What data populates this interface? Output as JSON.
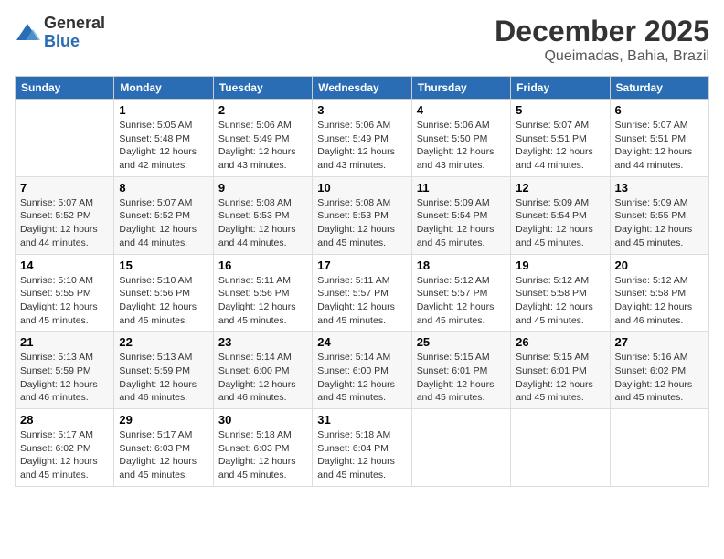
{
  "logo": {
    "general": "General",
    "blue": "Blue"
  },
  "title": "December 2025",
  "subtitle": "Queimadas, Bahia, Brazil",
  "days_of_week": [
    "Sunday",
    "Monday",
    "Tuesday",
    "Wednesday",
    "Thursday",
    "Friday",
    "Saturday"
  ],
  "weeks": [
    [
      {
        "day": null,
        "info": null
      },
      {
        "day": "1",
        "sunrise": "5:05 AM",
        "sunset": "5:48 PM",
        "daylight": "12 hours and 42 minutes."
      },
      {
        "day": "2",
        "sunrise": "5:06 AM",
        "sunset": "5:49 PM",
        "daylight": "12 hours and 43 minutes."
      },
      {
        "day": "3",
        "sunrise": "5:06 AM",
        "sunset": "5:49 PM",
        "daylight": "12 hours and 43 minutes."
      },
      {
        "day": "4",
        "sunrise": "5:06 AM",
        "sunset": "5:50 PM",
        "daylight": "12 hours and 43 minutes."
      },
      {
        "day": "5",
        "sunrise": "5:07 AM",
        "sunset": "5:51 PM",
        "daylight": "12 hours and 44 minutes."
      },
      {
        "day": "6",
        "sunrise": "5:07 AM",
        "sunset": "5:51 PM",
        "daylight": "12 hours and 44 minutes."
      }
    ],
    [
      {
        "day": "7",
        "sunrise": "5:07 AM",
        "sunset": "5:52 PM",
        "daylight": "12 hours and 44 minutes."
      },
      {
        "day": "8",
        "sunrise": "5:07 AM",
        "sunset": "5:52 PM",
        "daylight": "12 hours and 44 minutes."
      },
      {
        "day": "9",
        "sunrise": "5:08 AM",
        "sunset": "5:53 PM",
        "daylight": "12 hours and 44 minutes."
      },
      {
        "day": "10",
        "sunrise": "5:08 AM",
        "sunset": "5:53 PM",
        "daylight": "12 hours and 45 minutes."
      },
      {
        "day": "11",
        "sunrise": "5:09 AM",
        "sunset": "5:54 PM",
        "daylight": "12 hours and 45 minutes."
      },
      {
        "day": "12",
        "sunrise": "5:09 AM",
        "sunset": "5:54 PM",
        "daylight": "12 hours and 45 minutes."
      },
      {
        "day": "13",
        "sunrise": "5:09 AM",
        "sunset": "5:55 PM",
        "daylight": "12 hours and 45 minutes."
      }
    ],
    [
      {
        "day": "14",
        "sunrise": "5:10 AM",
        "sunset": "5:55 PM",
        "daylight": "12 hours and 45 minutes."
      },
      {
        "day": "15",
        "sunrise": "5:10 AM",
        "sunset": "5:56 PM",
        "daylight": "12 hours and 45 minutes."
      },
      {
        "day": "16",
        "sunrise": "5:11 AM",
        "sunset": "5:56 PM",
        "daylight": "12 hours and 45 minutes."
      },
      {
        "day": "17",
        "sunrise": "5:11 AM",
        "sunset": "5:57 PM",
        "daylight": "12 hours and 45 minutes."
      },
      {
        "day": "18",
        "sunrise": "5:12 AM",
        "sunset": "5:57 PM",
        "daylight": "12 hours and 45 minutes."
      },
      {
        "day": "19",
        "sunrise": "5:12 AM",
        "sunset": "5:58 PM",
        "daylight": "12 hours and 45 minutes."
      },
      {
        "day": "20",
        "sunrise": "5:12 AM",
        "sunset": "5:58 PM",
        "daylight": "12 hours and 46 minutes."
      }
    ],
    [
      {
        "day": "21",
        "sunrise": "5:13 AM",
        "sunset": "5:59 PM",
        "daylight": "12 hours and 46 minutes."
      },
      {
        "day": "22",
        "sunrise": "5:13 AM",
        "sunset": "5:59 PM",
        "daylight": "12 hours and 46 minutes."
      },
      {
        "day": "23",
        "sunrise": "5:14 AM",
        "sunset": "6:00 PM",
        "daylight": "12 hours and 46 minutes."
      },
      {
        "day": "24",
        "sunrise": "5:14 AM",
        "sunset": "6:00 PM",
        "daylight": "12 hours and 45 minutes."
      },
      {
        "day": "25",
        "sunrise": "5:15 AM",
        "sunset": "6:01 PM",
        "daylight": "12 hours and 45 minutes."
      },
      {
        "day": "26",
        "sunrise": "5:15 AM",
        "sunset": "6:01 PM",
        "daylight": "12 hours and 45 minutes."
      },
      {
        "day": "27",
        "sunrise": "5:16 AM",
        "sunset": "6:02 PM",
        "daylight": "12 hours and 45 minutes."
      }
    ],
    [
      {
        "day": "28",
        "sunrise": "5:17 AM",
        "sunset": "6:02 PM",
        "daylight": "12 hours and 45 minutes."
      },
      {
        "day": "29",
        "sunrise": "5:17 AM",
        "sunset": "6:03 PM",
        "daylight": "12 hours and 45 minutes."
      },
      {
        "day": "30",
        "sunrise": "5:18 AM",
        "sunset": "6:03 PM",
        "daylight": "12 hours and 45 minutes."
      },
      {
        "day": "31",
        "sunrise": "5:18 AM",
        "sunset": "6:04 PM",
        "daylight": "12 hours and 45 minutes."
      },
      {
        "day": null,
        "info": null
      },
      {
        "day": null,
        "info": null
      },
      {
        "day": null,
        "info": null
      }
    ]
  ],
  "labels": {
    "sunrise_prefix": "Sunrise: ",
    "sunset_prefix": "Sunset: ",
    "daylight_label": "Daylight: "
  }
}
